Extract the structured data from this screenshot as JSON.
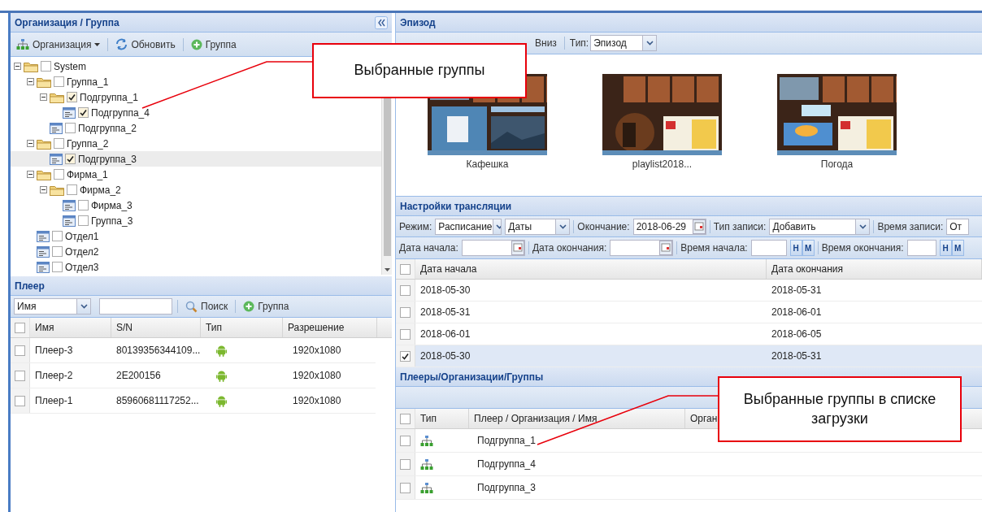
{
  "org_panel": {
    "title": "Организация / Группа",
    "toolbar": [
      {
        "kind": "menu",
        "label": "Организация",
        "caret": true
      },
      {
        "kind": "refresh",
        "label": "Обновить"
      },
      {
        "kind": "add",
        "label": "Группа"
      }
    ],
    "tree": [
      {
        "kind": "folder",
        "label": "System",
        "checked": false,
        "selected": false,
        "expanded": true,
        "children": [
          {
            "kind": "folder",
            "label": "Группа_1",
            "checked": false,
            "selected": false,
            "expanded": true,
            "children": [
              {
                "kind": "folder",
                "label": "Подгруппа_1",
                "checked": true,
                "selected": false,
                "expanded": true,
                "children": [
                  {
                    "kind": "leaf",
                    "label": "Подгруппа_4",
                    "checked": true,
                    "selected": false
                  }
                ]
              },
              {
                "kind": "leaf",
                "label": "Подгруппа_2",
                "checked": false,
                "selected": false
              }
            ]
          },
          {
            "kind": "folder",
            "label": "Группа_2",
            "checked": false,
            "selected": false,
            "expanded": true,
            "children": [
              {
                "kind": "leaf",
                "label": "Подгруппа_3",
                "checked": true,
                "selected": true
              }
            ]
          },
          {
            "kind": "folder",
            "label": "Фирма_1",
            "checked": false,
            "selected": false,
            "expanded": true,
            "children": [
              {
                "kind": "folder",
                "label": "Фирма_2",
                "checked": false,
                "selected": false,
                "expanded": true,
                "children": [
                  {
                    "kind": "leaf",
                    "label": "Фирма_3",
                    "checked": false,
                    "selected": false
                  },
                  {
                    "kind": "leaf",
                    "label": "Группа_3",
                    "checked": false,
                    "selected": false
                  }
                ]
              }
            ]
          },
          {
            "kind": "leaf",
            "label": "Отдел1",
            "checked": false,
            "selected": false
          },
          {
            "kind": "leaf",
            "label": "Отдел2",
            "checked": false,
            "selected": false
          },
          {
            "kind": "leaf",
            "label": "Отдел3",
            "checked": false,
            "selected": false
          }
        ]
      }
    ]
  },
  "player_panel": {
    "title": "Плеер",
    "filter": {
      "value": "Имя"
    },
    "toolbar": [
      {
        "kind": "search",
        "label": "Поиск"
      },
      {
        "kind": "add",
        "label": "Группа"
      }
    ],
    "all_checked": false,
    "columns": [
      "Имя",
      "S/N",
      "Тип",
      "Разрешение"
    ],
    "rows": [
      {
        "name": "Плеер-3",
        "sn": "80139356344109...",
        "resolution": "1920x1080",
        "checked": false
      },
      {
        "name": "Плеер-2",
        "sn": "2E200156",
        "resolution": "1920x1080",
        "checked": false
      },
      {
        "name": "Плеер-1",
        "sn": "85960681117252...",
        "resolution": "1920x1080",
        "checked": false
      }
    ]
  },
  "episode_panel": {
    "title": "Эпизод",
    "toolbar": {
      "button": "Вниз",
      "type_label": "Тип:",
      "type_value": "Эпизод"
    },
    "episodes": [
      {
        "kind": "picture",
        "label": "Кафешка"
      },
      {
        "kind": "picture",
        "label": "playlist2018..."
      },
      {
        "kind": "picture",
        "label": "Погода"
      }
    ]
  },
  "broadcast_panel": {
    "title": "Настройки трансляции",
    "row1": {
      "mode_label": "Режим:",
      "mode_value": "Расписание",
      "dates_value": "Даты",
      "end_label": "Окончание:",
      "end_value": "2018-06-29",
      "record_type_label": "Тип записи:",
      "record_type_value": "Добавить",
      "record_time_label": "Время записи:",
      "record_time_value": "От"
    },
    "row2": {
      "start_date_label": "Дата начала:",
      "end_date_label": "Дата окончания:",
      "start_time_label": "Время начала:",
      "start_hour": "H",
      "start_minute": "M",
      "end_time_label": "Время окончания:",
      "end_hour": "H",
      "end_minute": "M"
    },
    "all_checked": false,
    "columns": [
      "Дата начала",
      "Дата окончания"
    ],
    "rows": [
      {
        "start": "2018-05-30",
        "end": "2018-05-31",
        "checked": false
      },
      {
        "start": "2018-05-31",
        "end": "2018-06-01",
        "checked": false
      },
      {
        "start": "2018-06-01",
        "end": "2018-06-05",
        "checked": false
      },
      {
        "start": "2018-05-30",
        "end": "2018-05-31",
        "checked": true
      }
    ]
  },
  "targets_panel": {
    "title": "Плееры/Организации/Группы",
    "all_checked": false,
    "columns": [
      "Тип",
      "Плеер / Организация / Имя",
      "Орган"
    ],
    "rows": [
      {
        "name": "Подгруппа_1",
        "checked": false
      },
      {
        "name": "Подгруппа_4",
        "checked": false
      },
      {
        "name": "Подгруппа_3",
        "checked": false
      }
    ]
  },
  "callouts": [
    {
      "text": "Выбранные группы"
    },
    {
      "text": "Выбранные группы в списке загрузки"
    }
  ]
}
